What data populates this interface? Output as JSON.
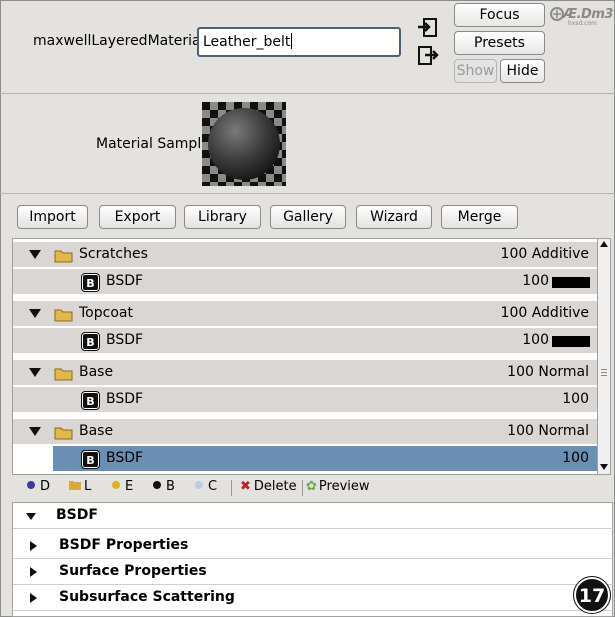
{
  "header": {
    "material_label": "maxwellLayeredMaterial:",
    "material_name": "Leather_belt",
    "buttons": {
      "focus": "Focus",
      "presets": "Presets",
      "show": "Show",
      "hide": "Hide"
    },
    "icons": [
      "import-arrow-icon",
      "export-arrow-icon"
    ],
    "watermark": {
      "text": "Æ.Dm3",
      "sub": "hxsd.com"
    }
  },
  "sample": {
    "label": "Material Sample"
  },
  "toolbar": {
    "import": "Import",
    "export": "Export",
    "library": "Library",
    "gallery": "Gallery",
    "wizard": "Wizard",
    "merge": "Merge"
  },
  "layers": [
    {
      "name": "Scratches",
      "value": "100 Additive",
      "bsdf": {
        "name": "BSDF",
        "value": "100",
        "swatch": "#000000"
      }
    },
    {
      "name": "Topcoat",
      "value": "100 Additive",
      "bsdf": {
        "name": "BSDF",
        "value": "100",
        "swatch": "#000000"
      }
    },
    {
      "name": "Base",
      "value": "100 Normal",
      "bsdf": {
        "name": "BSDF",
        "value": "100"
      }
    },
    {
      "name": "Base",
      "value": "100 Normal",
      "bsdf": {
        "name": "BSDF",
        "value": "100",
        "selected": true
      }
    }
  ],
  "bsdf_badge": "B",
  "legend": {
    "items": [
      {
        "letter": "D",
        "color": "#3a3aa8"
      },
      {
        "letter": "L",
        "color": "#d8a93a"
      },
      {
        "letter": "E",
        "color": "#e0b020"
      },
      {
        "letter": "B",
        "color": "#111111"
      },
      {
        "letter": "C",
        "color": "#b8cde6"
      }
    ],
    "delete": "Delete",
    "preview": "Preview"
  },
  "properties": {
    "section": "BSDF",
    "items": [
      "BSDF Properties",
      "Surface Properties",
      "Subsurface Scattering"
    ]
  },
  "step_number": "17",
  "colors": {
    "selection": "#6b8fb3",
    "row_bg": "#d9d6d3",
    "panel_bg": "#e4e2df"
  }
}
